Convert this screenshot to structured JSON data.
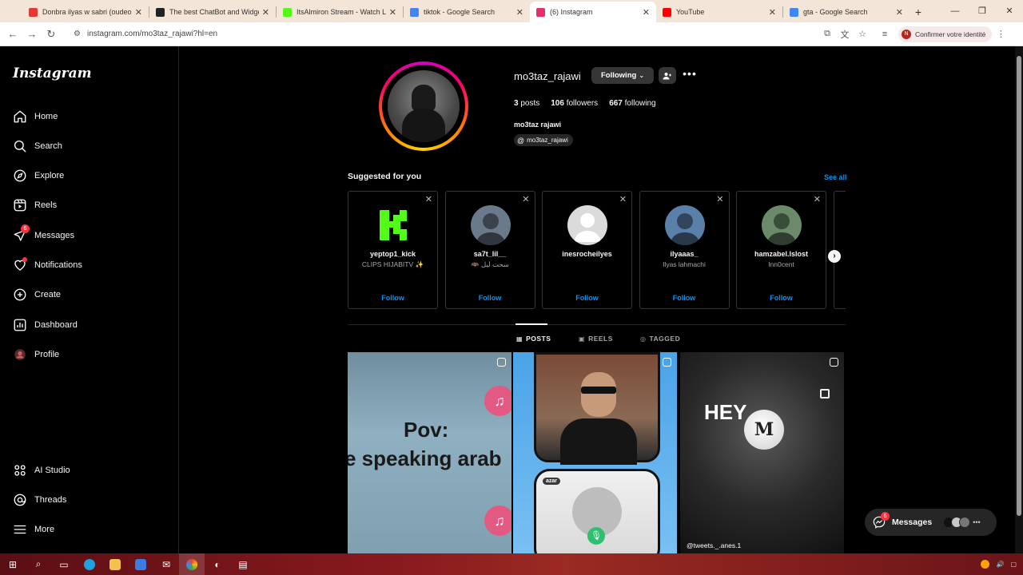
{
  "browser": {
    "tabs": [
      {
        "title": "Donbra ilyas w sabri (oudeo m...",
        "color": "#e53935",
        "active": false
      },
      {
        "title": "The best ChatBot and Widgets",
        "color": "#222222",
        "active": false
      },
      {
        "title": "ItsAlmiron Stream - Watch Live",
        "color": "#53fc18",
        "active": false
      },
      {
        "title": "tiktok - Google Search",
        "color": "#4285f4",
        "active": false
      },
      {
        "title": "(6) Instagram",
        "color": "#e1306c",
        "active": true
      },
      {
        "title": "YouTube",
        "color": "#ff0000",
        "active": false
      },
      {
        "title": "gta - Google Search",
        "color": "#4285f4",
        "active": false
      }
    ],
    "new_tab": "+",
    "url": "instagram.com/mo3taz_rajawi?hl=en",
    "identity_label": "Confirmer votre identité"
  },
  "sidebar": {
    "logo": "Instagram",
    "items": [
      {
        "label": "Home",
        "icon": "home-icon"
      },
      {
        "label": "Search",
        "icon": "search-icon"
      },
      {
        "label": "Explore",
        "icon": "compass-icon"
      },
      {
        "label": "Reels",
        "icon": "reels-icon"
      },
      {
        "label": "Messages",
        "icon": "messenger-icon",
        "badge": "6"
      },
      {
        "label": "Notifications",
        "icon": "heart-icon"
      },
      {
        "label": "Create",
        "icon": "plus-square-icon"
      },
      {
        "label": "Dashboard",
        "icon": "dashboard-icon"
      },
      {
        "label": "Profile",
        "icon": "profile-avatar"
      },
      {
        "label": "AI Studio",
        "icon": "ai-studio-icon"
      },
      {
        "label": "Threads",
        "icon": "threads-icon"
      },
      {
        "label": "More",
        "icon": "menu-icon"
      }
    ]
  },
  "profile": {
    "username": "mo3taz_rajawi",
    "following_label": "Following",
    "posts_count": "3",
    "posts_label": "posts",
    "followers_count": "106",
    "followers_label": "followers",
    "following_count": "667",
    "following_text": "following",
    "full_name": "mo3taz rajawi",
    "threads_handle": "mo3taz_rajawi"
  },
  "suggested": {
    "title": "Suggested for you",
    "see_all": "See all",
    "follow_label": "Follow",
    "cards": [
      {
        "name": "yeptop1_kick",
        "sub": "CLIPS HIJABITV ✨",
        "avatar_color": "#53fc18"
      },
      {
        "name": "sa7t_lil__",
        "sub": "🦇 سحت ليل",
        "avatar_color": "#6a7a8a"
      },
      {
        "name": "inesrocheilyes",
        "sub": "",
        "avatar_color": "#dbdbdb"
      },
      {
        "name": "ilyaaas_",
        "sub": "Ilyas lahmachi",
        "avatar_color": "#5a7fa8"
      },
      {
        "name": "hamzabel.lslost",
        "sub": "Inn0cent",
        "avatar_color": "#6a8a6a"
      }
    ]
  },
  "tabs": {
    "posts": "POSTS",
    "reels": "REELS",
    "tagged": "TAGGED"
  },
  "posts": {
    "p1_line1": "Pov:",
    "p1_line2": "e speaking arab",
    "p3_text": "HEY",
    "p3_moon": "M",
    "p3_handle": "@tweets._.anes.1",
    "p2_app_label": "azar"
  },
  "messages_pill": {
    "label": "Messages",
    "badge": "6"
  }
}
